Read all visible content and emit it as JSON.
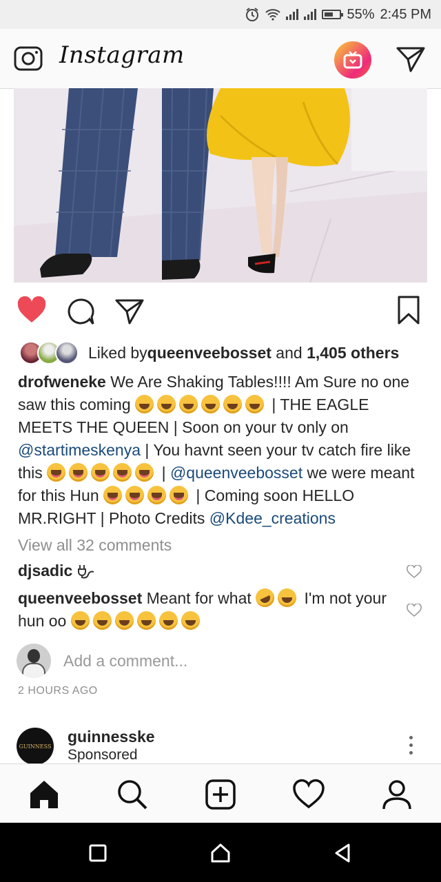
{
  "status_bar": {
    "battery": "55%",
    "time": "2:45 PM"
  },
  "header": {
    "app_title": "Instagram",
    "icons": [
      "camera-icon",
      "igtv-icon",
      "direct-send-icon"
    ]
  },
  "post": {
    "liked_by_prefix": "Liked by ",
    "liked_by_user": "queenveebosset",
    "liked_by_and": " and ",
    "liked_by_count": "1,405 others",
    "caption": {
      "user": "drofweneke",
      "text1": " We Are Shaking Tables!!!! Am Sure no one saw this coming ",
      "text2": " | THE EAGLE MEETS THE QUEEN | Soon on your tv only on ",
      "mention1": "@startimeskenya",
      "text3": " | You havnt seen your tv catch fire like this ",
      "text4": " | ",
      "mention2": "@queenveebosset",
      "text5": " we were meant for this Hun ",
      "text6": " | Coming soon HELLO MR.RIGHT | Photo Credits ",
      "mention3": "@Kdee_creations"
    },
    "view_all_comments": "View all 32 comments",
    "comments": [
      {
        "user": "djsadic",
        "text": ""
      },
      {
        "user": "queenveebosset",
        "text": " Meant for what ",
        "text2": " I'm not your hun oo "
      }
    ],
    "add_comment_placeholder": "Add a comment...",
    "timestamp": "2 HOURS AGO"
  },
  "next_post": {
    "user": "guinnesske",
    "label": "Sponsored",
    "avatar_text": "GUINNESS"
  },
  "tabbar": {
    "tabs": [
      "home-icon",
      "search-icon",
      "new-post-icon",
      "activity-heart-icon",
      "profile-icon"
    ]
  },
  "colors": {
    "like_red": "#ed4956",
    "mention_blue": "#1a4a7a",
    "igtv_orange": "#f56040"
  }
}
